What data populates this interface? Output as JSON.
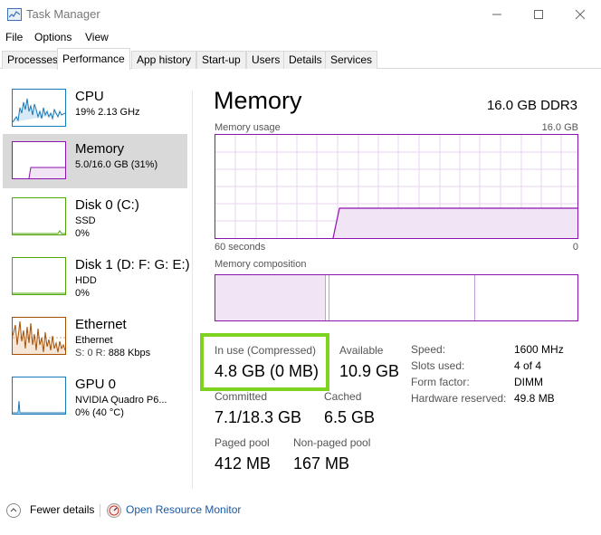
{
  "window": {
    "title": "Task Manager",
    "icon": "task-manager-icon"
  },
  "menu": {
    "items": [
      "File",
      "Options",
      "View"
    ]
  },
  "tabs": [
    {
      "label": "Processes"
    },
    {
      "label": "Performance",
      "active": true
    },
    {
      "label": "App history"
    },
    {
      "label": "Start-up"
    },
    {
      "label": "Users"
    },
    {
      "label": "Details"
    },
    {
      "label": "Services"
    }
  ],
  "sidebar": {
    "items": [
      {
        "title": "CPU",
        "line1": "19% 2.13 GHz",
        "line2": "",
        "color": "#1779ba"
      },
      {
        "title": "Memory",
        "line1": "5.0/16.0 GB (31%)",
        "line2": "",
        "color": "#8b12ae",
        "active": true
      },
      {
        "title": "Disk 0 (C:)",
        "line1": "SSD",
        "line2": "0%",
        "color": "#4da60c"
      },
      {
        "title": "Disk 1 (D: F: G: E:)",
        "line1": "HDD",
        "line2": "0%",
        "color": "#4da60c"
      },
      {
        "title": "Ethernet",
        "line1": "Ethernet",
        "line2_prefix": "S: 0 R: ",
        "line2": "888 Kbps",
        "color": "#a74f01"
      },
      {
        "title": "GPU 0",
        "line1": "NVIDIA Quadro P6...",
        "line2": "0% (40 °C)",
        "color": "#1779ba"
      }
    ]
  },
  "panel": {
    "title": "Memory",
    "spec": "16.0 GB DDR3",
    "usage_label": "Memory usage",
    "usage_max": "16.0 GB",
    "time_left": "60 seconds",
    "time_right": "0",
    "composition_label": "Memory composition",
    "usage_fraction": 0.31,
    "stats": {
      "in_use_label": "In use (Compressed)",
      "in_use_value": "4.8 GB (0 MB)",
      "available_label": "Available",
      "available_value": "10.9 GB",
      "committed_label": "Committed",
      "committed_value": "7.1/18.3 GB",
      "cached_label": "Cached",
      "cached_value": "6.5 GB",
      "paged_label": "Paged pool",
      "paged_value": "412 MB",
      "nonpaged_label": "Non-paged pool",
      "nonpaged_value": "167 MB"
    },
    "specs": [
      {
        "label": "Speed:",
        "value": "1600 MHz"
      },
      {
        "label": "Slots used:",
        "value": "4 of 4"
      },
      {
        "label": "Form factor:",
        "value": "DIMM"
      },
      {
        "label": "Hardware reserved:",
        "value": "49.8 MB"
      }
    ]
  },
  "footer": {
    "fewer_details": "Fewer details",
    "open_monitor": "Open Resource Monitor"
  },
  "colors": {
    "memory": "#8b12ae",
    "highlight": "#7ed321",
    "link": "#1a5aa6"
  }
}
